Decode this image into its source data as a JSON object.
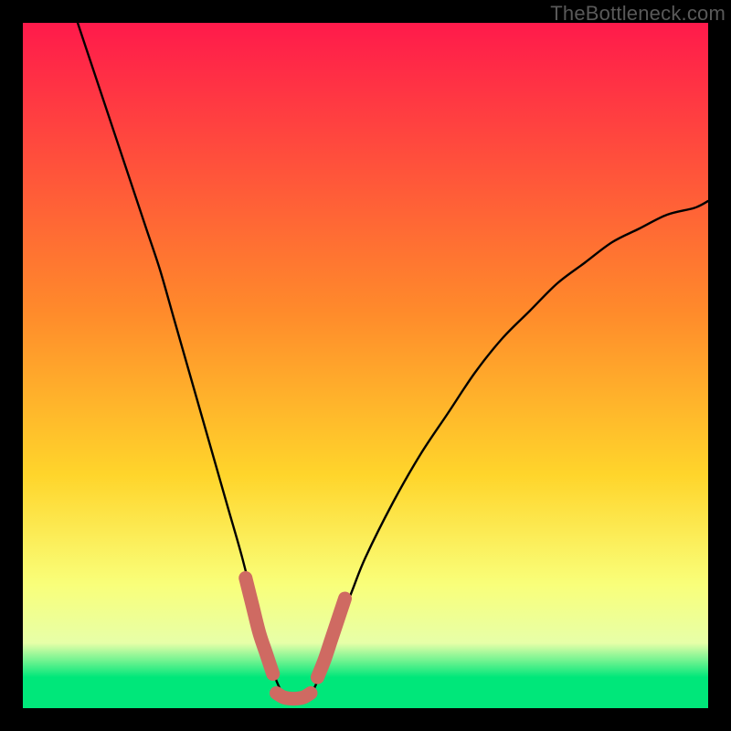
{
  "watermark": "TheBottleneck.com",
  "colors": {
    "bg_black": "#000000",
    "curve": "#000000",
    "highlight": "#cf6a62",
    "grad_top": "#ff1a4b",
    "grad_mid1": "#ff8a2b",
    "grad_mid2": "#ffd52b",
    "grad_low": "#f9ff7a",
    "grad_pale": "#e7ffa8",
    "grad_green": "#00e77a"
  },
  "chart_data": {
    "type": "line",
    "title": "",
    "xlabel": "",
    "ylabel": "",
    "xlim": [
      0,
      100
    ],
    "ylim": [
      0,
      100
    ],
    "annotations": [],
    "series": [
      {
        "name": "bottleneck-curve",
        "x": [
          8,
          10,
          12,
          14,
          16,
          18,
          20,
          22,
          24,
          26,
          28,
          30,
          32,
          34,
          35,
          36,
          37,
          38,
          39,
          40,
          41,
          42,
          43,
          44,
          46,
          48,
          50,
          54,
          58,
          62,
          66,
          70,
          74,
          78,
          82,
          86,
          90,
          94,
          98,
          100
        ],
        "y": [
          100,
          94,
          88,
          82,
          76,
          70,
          64,
          57,
          50,
          43,
          36,
          29,
          22,
          14,
          10,
          7,
          4,
          2,
          1,
          1,
          1,
          2,
          4,
          7,
          12,
          17,
          22,
          30,
          37,
          43,
          49,
          54,
          58,
          62,
          65,
          68,
          70,
          72,
          73,
          74
        ]
      }
    ],
    "highlight_segments": [
      {
        "name": "left-descent",
        "x": [
          32.5,
          33.5,
          34.5,
          35.5,
          36.5
        ],
        "y": [
          19,
          15,
          11,
          8,
          5
        ]
      },
      {
        "name": "valley-floor",
        "x": [
          37,
          38,
          39,
          40,
          41,
          42
        ],
        "y": [
          2.2,
          1.6,
          1.4,
          1.4,
          1.6,
          2.2
        ]
      },
      {
        "name": "right-ascent",
        "x": [
          43,
          44,
          45,
          46,
          47
        ],
        "y": [
          4.5,
          7,
          10,
          13,
          16
        ]
      }
    ],
    "gradient_stops": [
      {
        "offset": 0.0,
        "key": "grad_top"
      },
      {
        "offset": 0.42,
        "key": "grad_mid1"
      },
      {
        "offset": 0.66,
        "key": "grad_mid2"
      },
      {
        "offset": 0.82,
        "key": "grad_low"
      },
      {
        "offset": 0.905,
        "key": "grad_pale"
      },
      {
        "offset": 0.955,
        "key": "grad_green"
      },
      {
        "offset": 1.0,
        "key": "grad_green"
      }
    ]
  }
}
